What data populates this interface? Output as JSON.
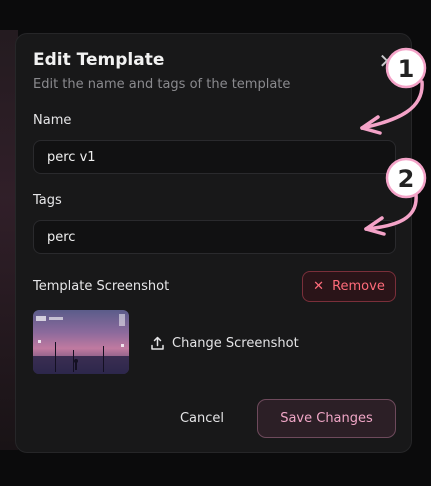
{
  "dialog": {
    "title": "Edit Template",
    "subtitle": "Edit the name and tags of the template",
    "close_icon": "close-icon"
  },
  "name_field": {
    "label": "Name",
    "value": "perc v1"
  },
  "tags_field": {
    "label": "Tags",
    "value": "perc"
  },
  "screenshot": {
    "label": "Template Screenshot",
    "remove_label": "Remove",
    "change_label": "Change Screenshot"
  },
  "footer": {
    "cancel_label": "Cancel",
    "save_label": "Save Changes"
  },
  "annotations": {
    "marker_1": "1",
    "marker_2": "2"
  },
  "colors": {
    "accent": "#f0a6c6",
    "danger": "#ff6b7a",
    "annotation": "#f4a3c8"
  }
}
